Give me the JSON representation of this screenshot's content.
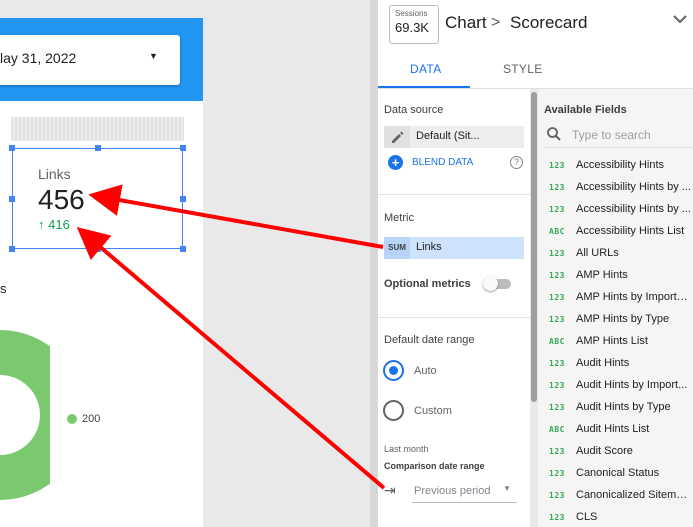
{
  "report": {
    "date_value": "lay 31, 2022",
    "scorecard": {
      "label": "Links",
      "value": "456",
      "comparison": "416",
      "comparison_arrow": "↑"
    },
    "chart": {
      "title": "s",
      "legend_value": "200"
    }
  },
  "panel": {
    "sessions_chip": {
      "label": "Sessions",
      "value": "69.3K"
    },
    "breadcrumb": {
      "chart": "Chart",
      "separator": ">",
      "type": "Scorecard"
    },
    "tabs": [
      {
        "label": "DATA",
        "active": true
      },
      {
        "label": "STYLE",
        "active": false
      }
    ],
    "data": {
      "data_source_label": "Data source",
      "data_source_value": "Default (Sit...",
      "blend_label": "BLEND DATA",
      "help_glyph": "?",
      "metric_label": "Metric",
      "metric_agg": "SUM",
      "metric_value": "Links",
      "optional_metrics_label": "Optional metrics",
      "optional_metrics_on": false,
      "default_date_range_label": "Default date range",
      "auto_label": "Auto",
      "custom_label": "Custom",
      "auto_selected": true,
      "last_month": "Last month",
      "comparison_label": "Comparison date range",
      "comparison_value": "Previous period"
    },
    "available_fields": {
      "label": "Available Fields",
      "search_placeholder": "Type to search",
      "fields": [
        {
          "type": "123",
          "name": "Accessibility Hints"
        },
        {
          "type": "123",
          "name": "Accessibility Hints by ..."
        },
        {
          "type": "123",
          "name": "Accessibility Hints by ..."
        },
        {
          "type": "ABC",
          "name": "Accessibility Hints List"
        },
        {
          "type": "123",
          "name": "All URLs"
        },
        {
          "type": "123",
          "name": "AMP Hints"
        },
        {
          "type": "123",
          "name": "AMP Hints by Importa..."
        },
        {
          "type": "123",
          "name": "AMP Hints by Type"
        },
        {
          "type": "ABC",
          "name": "AMP Hints List"
        },
        {
          "type": "123",
          "name": "Audit Hints"
        },
        {
          "type": "123",
          "name": "Audit Hints by Import..."
        },
        {
          "type": "123",
          "name": "Audit Hints by Type"
        },
        {
          "type": "ABC",
          "name": "Audit Hints List"
        },
        {
          "type": "123",
          "name": "Audit Score"
        },
        {
          "type": "123",
          "name": "Canonical Status"
        },
        {
          "type": "123",
          "name": "Canonicalized Sitema..."
        },
        {
          "type": "123",
          "name": "CLS"
        }
      ]
    }
  },
  "colors": {
    "accent": "#1a73e8",
    "header": "#2196f3",
    "positive": "#0f9d58",
    "donut": "#7bc96f",
    "arrow": "#ff0000"
  }
}
